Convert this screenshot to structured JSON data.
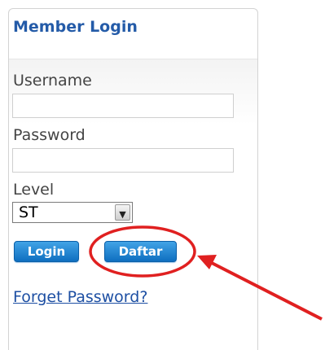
{
  "login_panel": {
    "title": "Member Login",
    "username_label": "Username",
    "username_value": "",
    "password_label": "Password",
    "password_value": "",
    "level_label": "Level",
    "level_selected": "ST",
    "login_button": "Login",
    "daftar_button": "Daftar",
    "forget_password_link": "Forget Password?"
  },
  "annotation": {
    "color": "#e02020"
  },
  "icons": {
    "dropdown_arrow": "chevron-down-icon"
  }
}
